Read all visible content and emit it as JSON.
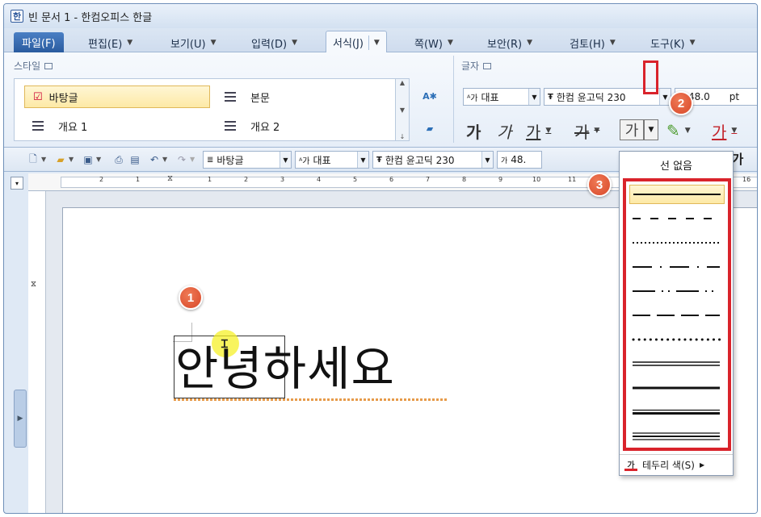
{
  "window": {
    "title": "빈 문서 1 - 한컴오피스 한글",
    "app_icon": "hwp-app-icon"
  },
  "menu": {
    "file": "파일(F)",
    "items": [
      "편집(E)",
      "보기(U)",
      "입력(D)"
    ],
    "active": "서식(J)",
    "rest": [
      "쪽(W)",
      "보안(R)",
      "검토(H)",
      "도구(K)"
    ]
  },
  "ribbon": {
    "style_group": "스타일",
    "styles": [
      "바탕글",
      "본문",
      "개요 1",
      "개요 2"
    ],
    "char_group": "글자",
    "lang_combo": "대표",
    "font_combo": "한컴 윤고딕 230",
    "size_combo": "48.0",
    "size_unit": "pt",
    "bold": "가",
    "italic": "가",
    "underline": "가",
    "strike": "가",
    "border_glyph": "가",
    "color_glyph": "가"
  },
  "toolbar": {
    "style_combo": "바탕글",
    "lang_combo": "대표",
    "font_combo": "한컴 윤고딕 230",
    "size_combo": "48.",
    "bold_glyph": "가"
  },
  "ruler": {
    "marks": [
      "2",
      "1",
      "1",
      "2",
      "3",
      "4",
      "5",
      "6",
      "7",
      "8",
      "9",
      "10",
      "11",
      "16"
    ]
  },
  "document": {
    "text": "안녕하세요"
  },
  "dropdown": {
    "none_label": "선 없음",
    "line_styles": [
      "solid",
      "dash",
      "dot",
      "dash-dot",
      "dash-dot-dot",
      "long-dash",
      "round-dot",
      "double",
      "thick",
      "thick-double",
      "triple"
    ],
    "footer_label": "테두리 색(S)",
    "footer_icon_glyph": "가"
  },
  "badges": [
    "1",
    "2",
    "3"
  ],
  "colors": {
    "highlight_red": "#d9232b",
    "badge_orange": "#e05a36",
    "selection_yellow": "#fde9a6"
  }
}
